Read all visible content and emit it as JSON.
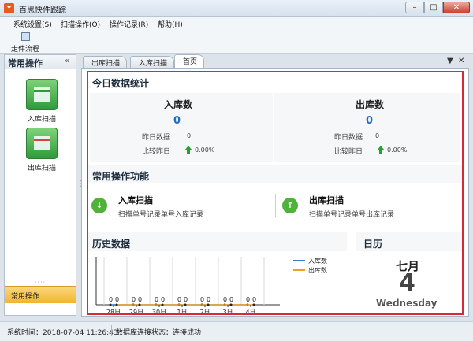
{
  "window": {
    "title": "百思快件跟踪"
  },
  "menu": [
    {
      "label": "系统设置(S)"
    },
    {
      "label": "扫描操作(O)"
    },
    {
      "label": "操作记录(R)"
    },
    {
      "label": "帮助(H)"
    }
  ],
  "toolbar": {
    "flow_label": "走件流程"
  },
  "sidebar": {
    "title": "常用操作",
    "collapse_glyph": "«",
    "items": [
      {
        "label": "入库扫描"
      },
      {
        "label": "出库扫描"
      }
    ],
    "footer_tab": "常用操作"
  },
  "tabs": [
    {
      "label": "出库扫描"
    },
    {
      "label": "入库扫描"
    },
    {
      "label": "首页"
    }
  ],
  "tab_controls": {
    "menu_glyph": "▼",
    "close_glyph": "✕"
  },
  "today_stats": {
    "title": "今日数据统计",
    "inbound": {
      "heading": "入库数",
      "value": "0",
      "yesterday_label": "昨日数据",
      "yesterday_value": "0",
      "compare_label": "比较昨日",
      "compare_value": "0.00%"
    },
    "outbound": {
      "heading": "出库数",
      "value": "0",
      "yesterday_label": "昨日数据",
      "yesterday_value": "0",
      "compare_label": "比较昨日",
      "compare_value": "0.00%"
    }
  },
  "functions": {
    "title": "常用操作功能",
    "items": [
      {
        "title": "入库扫描",
        "desc": "扫描单号记录单号入库记录",
        "icon": "↓"
      },
      {
        "title": "出库扫描",
        "desc": "扫描单号记录单号出库记录",
        "icon": "↑"
      }
    ]
  },
  "history": {
    "title": "历史数据"
  },
  "chart_data": {
    "type": "line",
    "categories": [
      "28日",
      "29日",
      "30日",
      "1日",
      "2日",
      "3日",
      "4日"
    ],
    "series": [
      {
        "name": "入库数",
        "values": [
          0,
          0,
          0,
          0,
          0,
          0,
          0
        ],
        "color": "#2f7fd1"
      },
      {
        "name": "出库数",
        "values": [
          0,
          0,
          0,
          0,
          0,
          0,
          0
        ],
        "color": "#f0a020"
      }
    ],
    "data_labels": [
      "0",
      "0",
      "0",
      "0",
      "0",
      "0",
      "0",
      "0",
      "0",
      "0",
      "0",
      "0",
      "0",
      "0"
    ],
    "legend": "top-right",
    "grid": true
  },
  "calendar": {
    "title": "日历",
    "month": "七月",
    "day": "4",
    "weekday": "Wednesday"
  },
  "statusbar": {
    "time": "系统时间：2018-07-04 11:26:43",
    "db_status": "数据库连接状态：连接成功"
  }
}
